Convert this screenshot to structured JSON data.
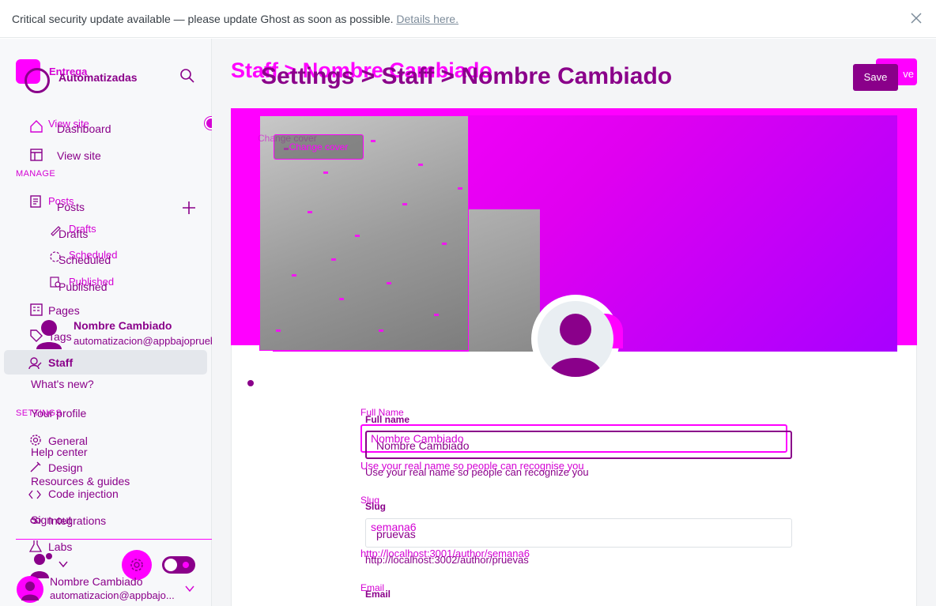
{
  "banner": {
    "message": "Critical security update available — please update Ghost as soon as possible.",
    "link": "Details here."
  },
  "sidebar": {
    "brand_ghost": "Entrega",
    "brand_name": "Automatizadas",
    "items_top": [
      {
        "ghost": "View site",
        "label": "Dashboard"
      },
      {
        "label": "View site"
      }
    ],
    "manage_label": "MANAGE",
    "posts": {
      "ghost": "Posts",
      "label": "Posts"
    },
    "drafts": {
      "ghost": "Drafts",
      "label": "Drafts"
    },
    "scheduled": {
      "ghost": "Scheduled",
      "label": "Scheduled"
    },
    "published": {
      "ghost": "Published",
      "label": "Published"
    },
    "pages": "Pages",
    "tags": "Tags",
    "staff": "Staff",
    "whats_new": "What's new?",
    "settings_label": "SETTINGS",
    "your_profile": "Your profile",
    "general": "General",
    "help_center": "Help center",
    "design": "Design",
    "resources": "Resources & guides",
    "code_injection": "Code injection",
    "sign_out": "Sign out",
    "integrations": "Integrations",
    "labs": "Labs",
    "popup_user": {
      "name": "Nombre Cambiado",
      "email": "automatizacion@appbajopruebas.com"
    },
    "footer_user": {
      "name": "Nombre Cambiado",
      "email": "automatizacion@appbajo..."
    }
  },
  "header": {
    "breadcrumb_ghost": "Staff  >  Nombre Cambiado",
    "breadcrumb": "Settings  >  Staff  >  Nombre Cambiado",
    "save_ghost": "ve",
    "save": "Save"
  },
  "cover": {
    "change_cover": "Change cover",
    "change_cover_ghost": "Change cover"
  },
  "form": {
    "full_name_ghost": "Full Name",
    "full_name_label": "Full name",
    "full_name_value_ghost": "Nombre Cambiado",
    "full_name_value": "Nombre Cambiado",
    "full_name_hint_ghost": "Use your real name so people can recognise you",
    "full_name_hint": "Use your real name so people can recognize you",
    "slug_ghost": "Slug",
    "slug_label": "Slug",
    "slug_value_ghost": "semana6",
    "slug_value": "pruevas",
    "slug_url_ghost": "http://localhost:3001/author/semana6",
    "slug_url": "http://localhost:3002/author/pruevas",
    "email_ghost": "Email",
    "email_label": "Email"
  },
  "colors": {
    "accent": "#ff00ff",
    "primary": "#8a008a",
    "sidebar_bg": "#f7f8fa"
  }
}
